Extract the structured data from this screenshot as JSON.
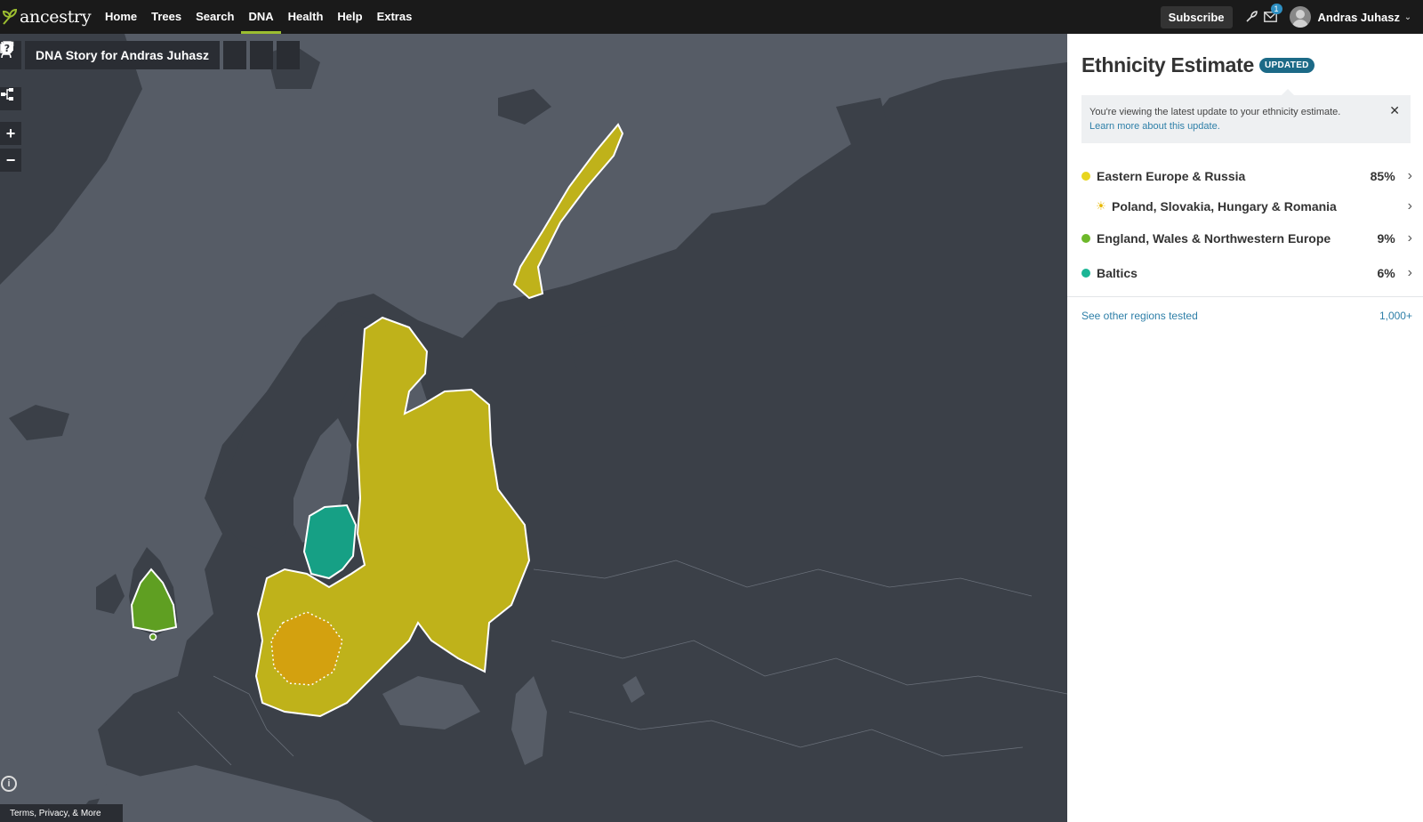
{
  "brand": {
    "logo_text": "ancestry"
  },
  "nav": {
    "items": [
      {
        "label": "Home"
      },
      {
        "label": "Trees"
      },
      {
        "label": "Search"
      },
      {
        "label": "DNA",
        "active": true
      },
      {
        "label": "Health"
      },
      {
        "label": "Help"
      },
      {
        "label": "Extras"
      }
    ],
    "subscribe_label": "Subscribe",
    "message_count": "1",
    "user_name": "Andras Juhasz"
  },
  "map": {
    "story_title": "DNA Story for Andras Juhasz",
    "zoom_in": "+",
    "zoom_out": "−",
    "info_label": "i",
    "terms_label": "Terms, Privacy, & More"
  },
  "panel": {
    "title": "Ethnicity Estimate",
    "badge": "UPDATED",
    "notice_text": "You're viewing the latest update to your ethnicity estimate.",
    "notice_link": "Learn more about this update.",
    "regions": [
      {
        "name": "Eastern Europe & Russia",
        "percent": "85%",
        "color": "#e8d51e"
      },
      {
        "name": "Poland, Slovakia, Hungary & Romania",
        "percent": "",
        "color": "#e8b800",
        "sub": true
      },
      {
        "name": "England, Wales & Northwestern Europe",
        "percent": "9%",
        "color": "#6db82a"
      },
      {
        "name": "Baltics",
        "percent": "6%",
        "color": "#1bb595"
      }
    ],
    "see_other_label": "See other regions tested",
    "see_other_count": "1,000+"
  },
  "colors": {
    "eastern_europe": "#bfb21a",
    "poland_subregion": "#d3a10f",
    "northwest_europe": "#5f9f22",
    "baltics": "#16a085",
    "ocean": "#565c66",
    "land": "#3b4048",
    "brand_green": "#9cbe30"
  }
}
